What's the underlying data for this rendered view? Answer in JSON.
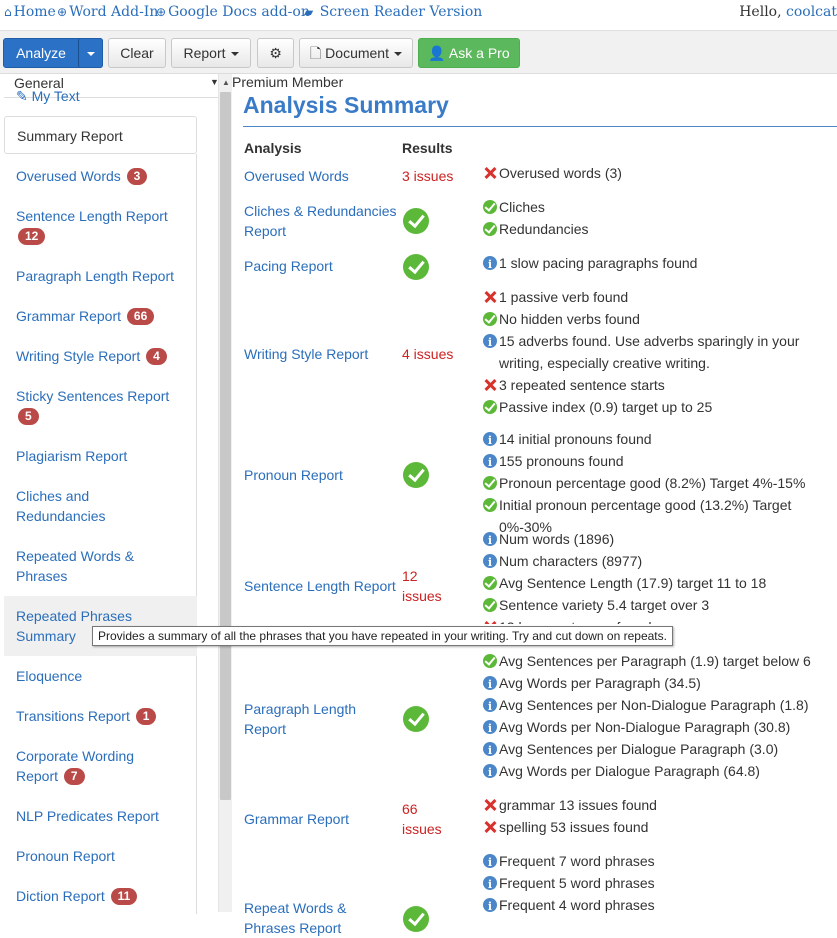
{
  "topnav": {
    "home": "Home",
    "word_addin": "Word Add-In",
    "google_docs": "Google Docs add-on",
    "screen_reader": "Screen Reader Version",
    "hello": "Hello,",
    "user": "coolcat"
  },
  "toolbar": {
    "analyze": "Analyze",
    "clear": "Clear",
    "report": "Report",
    "document": "Document",
    "ask_pro": "Ask a Pro"
  },
  "sidebar": {
    "select_value": "General",
    "my_text": "My Text",
    "summary_report": "Summary Report",
    "items": [
      {
        "label": "Overused Words",
        "badge": "3"
      },
      {
        "label": "Sentence Length Report",
        "badge": "12"
      },
      {
        "label": "Paragraph Length Report",
        "badge": ""
      },
      {
        "label": "Grammar Report",
        "badge": "66"
      },
      {
        "label": "Writing Style Report",
        "badge": "4"
      },
      {
        "label": "Sticky Sentences Report",
        "badge": "5"
      },
      {
        "label": "Plagiarism Report",
        "badge": ""
      },
      {
        "label": "Cliches and Redundancies",
        "badge": ""
      },
      {
        "label": "Repeated Words & Phrases",
        "badge": ""
      },
      {
        "label": "Repeated Phrases Summary",
        "badge": ""
      },
      {
        "label": "Eloquence",
        "badge": ""
      },
      {
        "label": "Transitions Report",
        "badge": "1"
      },
      {
        "label": "Corporate Wording Report",
        "badge": "7"
      },
      {
        "label": "NLP Predicates Report",
        "badge": ""
      },
      {
        "label": "Pronoun Report",
        "badge": ""
      },
      {
        "label": "Diction Report",
        "badge": "11"
      }
    ]
  },
  "tooltip": "Provides a summary of all the phrases that you have repeated in your writing. Try and cut down on repeats.",
  "main": {
    "premium": "Premium Member",
    "title": "Analysis Summary",
    "col_analysis": "Analysis",
    "col_results": "Results",
    "rows": [
      {
        "name": "Overused Words",
        "result": "3 issues",
        "details": [
          {
            "type": "bad",
            "text": "Overused words (3)"
          }
        ]
      },
      {
        "name": "Cliches & Redundancies Report",
        "result": "",
        "details": [
          {
            "type": "ok",
            "text": "Cliches"
          },
          {
            "type": "ok",
            "text": "Redundancies"
          }
        ]
      },
      {
        "name": "Pacing Report",
        "result": "",
        "details": [
          {
            "type": "info",
            "text": "1 slow pacing paragraphs found"
          }
        ]
      },
      {
        "name": "Writing Style Report",
        "result": "4 issues",
        "details": [
          {
            "type": "bad",
            "text": "1 passive verb found"
          },
          {
            "type": "ok",
            "text": "No hidden verbs found"
          },
          {
            "type": "info",
            "text": "15 adverbs found. Use adverbs sparingly in your writing, especially creative writing."
          },
          {
            "type": "bad",
            "text": "3 repeated sentence starts"
          },
          {
            "type": "ok",
            "text": "Passive index (0.9) target up to 25"
          }
        ]
      },
      {
        "name": "Pronoun Report",
        "result": "",
        "details": [
          {
            "type": "info",
            "text": "14 initial pronouns found"
          },
          {
            "type": "info",
            "text": "155 pronouns found"
          },
          {
            "type": "ok",
            "text": "Pronoun percentage good (8.2%) Target 4%-15%"
          },
          {
            "type": "ok",
            "text": "Initial pronoun percentage good (13.2%) Target 0%-30%"
          }
        ]
      },
      {
        "name": "Sentence Length Report",
        "result": "12 issues",
        "details": [
          {
            "type": "info",
            "text": "Num words (1896)"
          },
          {
            "type": "info",
            "text": "Num characters (8977)"
          },
          {
            "type": "ok",
            "text": "Avg Sentence Length (17.9) target 11 to 18"
          },
          {
            "type": "ok",
            "text": "Sentence variety 5.4 target over 3"
          },
          {
            "type": "bad",
            "text": "12 long sentences found"
          }
        ]
      },
      {
        "name": "Paragraph Length Report",
        "result": "",
        "details": [
          {
            "type": "ok",
            "text": "Avg Sentences per Paragraph (1.9) target below 6"
          },
          {
            "type": "info",
            "text": "Avg Words per Paragraph (34.5)"
          },
          {
            "type": "info",
            "text": "Avg Sentences per Non-Dialogue Paragraph (1.8)"
          },
          {
            "type": "info",
            "text": "Avg Words per Non-Dialogue Paragraph (30.8)"
          },
          {
            "type": "info",
            "text": "Avg Sentences per Dialogue Paragraph (3.0)"
          },
          {
            "type": "info",
            "text": "Avg Words per Dialogue Paragraph (64.8)"
          }
        ]
      },
      {
        "name": "Grammar Report",
        "result": "66 issues",
        "details": [
          {
            "type": "bad",
            "text": "grammar 13 issues found"
          },
          {
            "type": "bad",
            "text": "spelling 53 issues found"
          }
        ]
      },
      {
        "name": "Repeat Words & Phrases Report",
        "result": "",
        "details": [
          {
            "type": "info",
            "text": "Frequent 7 word phrases"
          },
          {
            "type": "info",
            "text": "Frequent 5 word phrases"
          },
          {
            "type": "info",
            "text": "Frequent 4 word phrases"
          }
        ]
      }
    ]
  }
}
